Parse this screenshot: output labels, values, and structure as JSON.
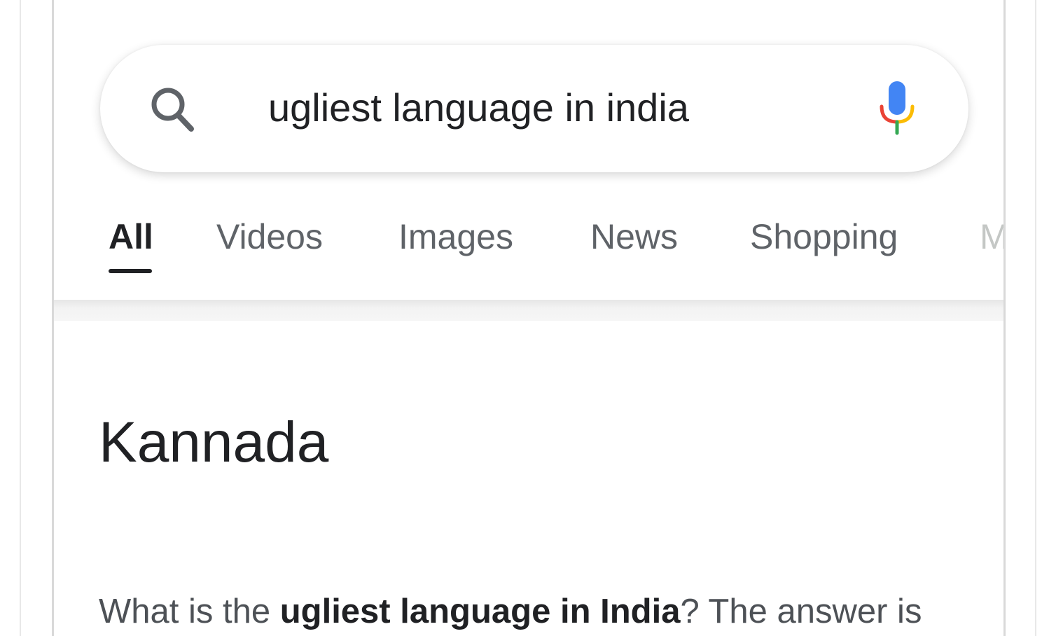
{
  "search": {
    "query": "ugliest language in india",
    "icon": "search-icon",
    "voice_icon": "mic-icon"
  },
  "tabs": [
    {
      "label": "All",
      "active": true
    },
    {
      "label": "Videos",
      "active": false
    },
    {
      "label": "Images",
      "active": false
    },
    {
      "label": "News",
      "active": false
    },
    {
      "label": "Shopping",
      "active": false
    },
    {
      "label": "M",
      "active": false
    }
  ],
  "result": {
    "answer": "Kannada",
    "snippet_prefix": "What is the ",
    "snippet_bold": "ugliest language in India",
    "snippet_suffix": "? The answer is"
  },
  "colors": {
    "text_primary": "#202124",
    "text_secondary": "#5f6368",
    "mic_blue": "#4285f4",
    "mic_red": "#ea4335",
    "mic_yellow": "#fbbc05",
    "mic_green": "#34a853"
  }
}
